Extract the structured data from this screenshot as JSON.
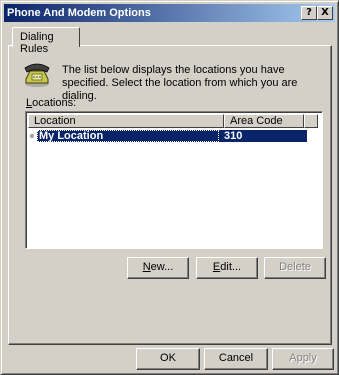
{
  "window": {
    "title": "Phone And Modem Options",
    "help_button": "?",
    "close_button": "X"
  },
  "tabs": [
    {
      "label": "Dialing Rules"
    }
  ],
  "main": {
    "description": "The list below displays the locations you have specified. Select the location from which you are dialing.",
    "locations_label_accel": "L",
    "locations_label_rest": "ocations:",
    "icon": "phone-icon"
  },
  "list": {
    "columns": [
      "Location",
      "Area Code"
    ],
    "rows": [
      {
        "location": "My Location",
        "area_code": "310",
        "selected": true
      }
    ]
  },
  "list_buttons": {
    "new_accel": "N",
    "new_rest": "ew...",
    "edit_accel": "E",
    "edit_rest": "dit...",
    "delete_label": "Delete"
  },
  "footer": {
    "ok_label": "OK",
    "cancel_label": "Cancel",
    "apply_label": "Apply"
  },
  "colors": {
    "titlebar_start": "#0a246a",
    "titlebar_end": "#a6caf0",
    "selection": "#0a246a",
    "face": "#d4d0c8"
  }
}
